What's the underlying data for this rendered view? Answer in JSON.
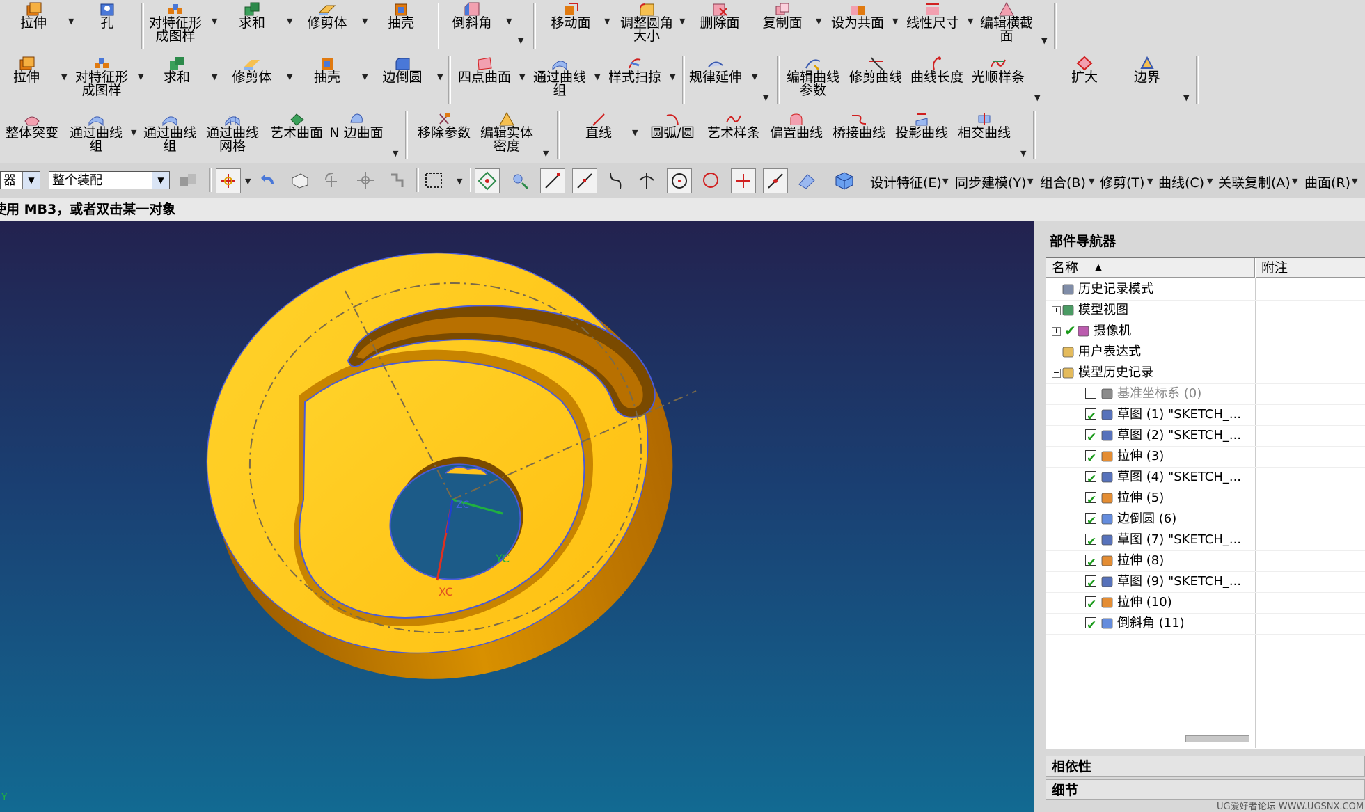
{
  "row1": {
    "items": [
      "拉伸",
      "孔",
      "对特征形成图样",
      "求和",
      "修剪体",
      "抽壳",
      "倒斜角",
      "移动面",
      "调整圆角大小",
      "删除面",
      "复制面",
      "设为共面",
      "线性尺寸",
      "编辑横截面"
    ]
  },
  "row2": {
    "items": [
      "拉伸",
      "对特征形成图样",
      "求和",
      "修剪体",
      "抽壳",
      "边倒圆",
      "四点曲面",
      "通过曲线组",
      "样式扫掠",
      "规律延伸",
      "编辑曲线参数",
      "修剪曲线",
      "曲线长度",
      "光顺样条",
      "扩大",
      "边界"
    ]
  },
  "row3": {
    "items": [
      "整体突变",
      "通过曲线组",
      "通过曲线组",
      "通过曲线网格",
      "艺术曲面",
      "N 边曲面",
      "移除参数",
      "编辑实体密度",
      "直线",
      "圆弧/圆",
      "艺术样条",
      "偏置曲线",
      "桥接曲线",
      "投影曲线",
      "相交曲线"
    ]
  },
  "toolbar4": {
    "filter_combo": "器",
    "assembly_combo": "整个装配",
    "menus": [
      "设计特征(E)",
      "同步建模(Y)",
      "组合(B)",
      "修剪(T)",
      "曲线(C)",
      "关联复制(A)",
      "曲面(R)"
    ]
  },
  "status": {
    "text": "使用 MB3，或者双击某一对象"
  },
  "viewport": {
    "axis_x": "XC",
    "axis_y": "YC",
    "axis_z": "ZC",
    "corner_axis": "Y"
  },
  "navigator": {
    "title": "部件导航器",
    "col_name": "名称",
    "col_note": "附注",
    "nodes": [
      {
        "label": "历史记录模式",
        "icon": "clock-icon"
      },
      {
        "label": "模型视图",
        "icon": "model-view-icon"
      },
      {
        "label": "摄像机",
        "icon": "camera-icon"
      },
      {
        "label": "用户表达式",
        "icon": "folder-icon"
      },
      {
        "label": "模型历史记录",
        "icon": "open-folder-icon"
      },
      {
        "label": "基准坐标系 (0)",
        "icon": "datum-csys-icon"
      },
      {
        "label": "草图 (1) \"SKETCH_...",
        "icon": "sketch-icon"
      },
      {
        "label": "草图 (2) \"SKETCH_...",
        "icon": "sketch-icon"
      },
      {
        "label": "拉伸 (3)",
        "icon": "extrude-icon"
      },
      {
        "label": "草图 (4) \"SKETCH_...",
        "icon": "sketch-icon"
      },
      {
        "label": "拉伸 (5)",
        "icon": "extrude-icon"
      },
      {
        "label": "边倒圆 (6)",
        "icon": "edge-blend-icon"
      },
      {
        "label": "草图 (7) \"SKETCH_...",
        "icon": "sketch-icon"
      },
      {
        "label": "拉伸 (8)",
        "icon": "extrude-icon"
      },
      {
        "label": "草图 (9) \"SKETCH_...",
        "icon": "sketch-icon"
      },
      {
        "label": "拉伸 (10)",
        "icon": "extrude-icon"
      },
      {
        "label": "倒斜角 (11)",
        "icon": "chamfer-icon"
      }
    ],
    "panel_dependencies": "相依性",
    "panel_details": "细节",
    "watermark": "UG爱好者论坛 WWW.UGSNX.COM"
  },
  "colors": {
    "part_yellow": "#ffc21a",
    "part_side": "#c98000",
    "part_edge": "#4a5bd8",
    "bg_top": "#23224f",
    "bg_bottom": "#126a92",
    "check_green": "#1a9a1a"
  }
}
